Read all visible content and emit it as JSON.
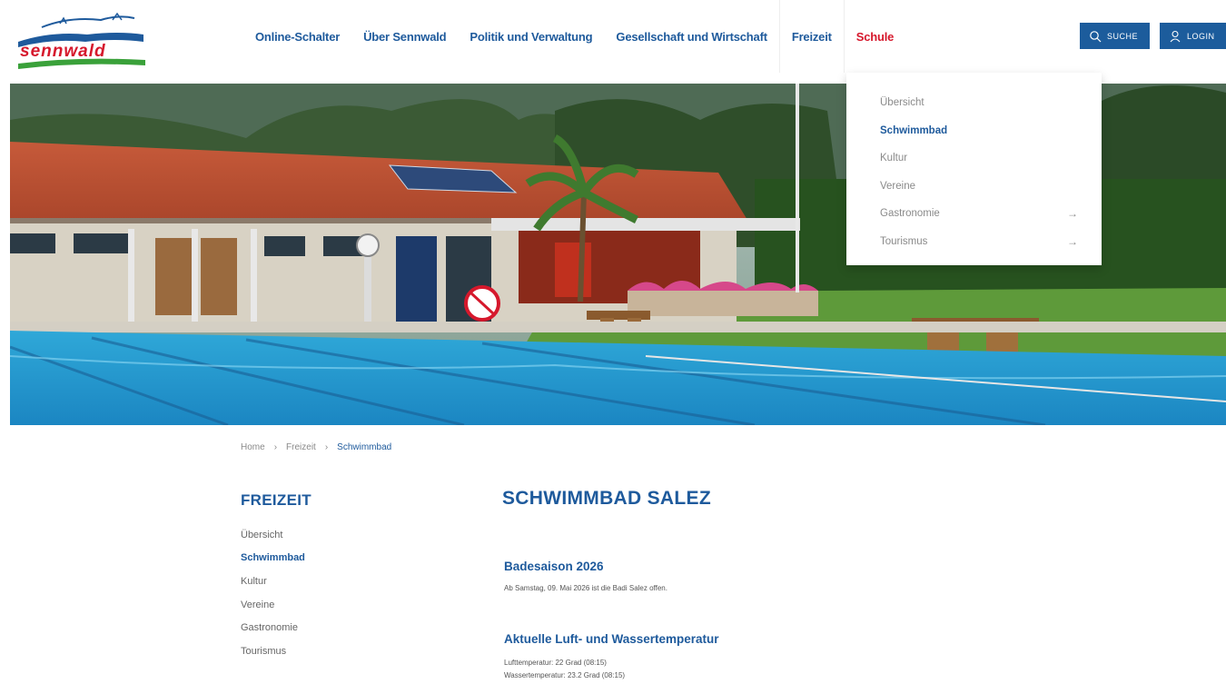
{
  "colors": {
    "brand_blue": "#1e5a9c",
    "accent_red": "#d6182c",
    "button_blue": "#1c5c9c"
  },
  "logo": {
    "text": "sennwald"
  },
  "nav": {
    "items": [
      {
        "label": "Online-Schalter"
      },
      {
        "label": "Über Sennwald"
      },
      {
        "label": "Politik und Verwaltung"
      },
      {
        "label": "Gesellschaft und Wirtschaft"
      },
      {
        "label": "Freizeit"
      },
      {
        "label": "Schule"
      }
    ]
  },
  "header_buttons": {
    "search": "SUCHE",
    "login": "LOGIN"
  },
  "dropdown": {
    "items": [
      {
        "label": "Übersicht",
        "arrow": ""
      },
      {
        "label": "Schwimmbad",
        "arrow": ""
      },
      {
        "label": "Kultur",
        "arrow": ""
      },
      {
        "label": "Vereine",
        "arrow": ""
      },
      {
        "label": "Gastronomie",
        "arrow": "→"
      },
      {
        "label": "Tourismus",
        "arrow": "→"
      }
    ]
  },
  "breadcrumb": {
    "home": "Home",
    "sep": "›",
    "level1": "Freizeit",
    "current": "Schwimmbad"
  },
  "sidebar": {
    "title": "FREIZEIT",
    "items": [
      {
        "label": "Übersicht"
      },
      {
        "label": "Schwimmbad"
      },
      {
        "label": "Kultur"
      },
      {
        "label": "Vereine"
      },
      {
        "label": "Gastronomie"
      },
      {
        "label": "Tourismus"
      }
    ]
  },
  "main": {
    "title": "SCHWIMMBAD SALEZ",
    "season_heading": "Badesaison 2026",
    "season_text": "Ab Samstag, 09. Mai 2026 ist die Badi Salez offen.",
    "temp_heading": "Aktuelle Luft- und Wassertemperatur",
    "air_temp": "Lufttemperatur: 22 Grad (08:15)",
    "water_temp": "Wassertemperatur: 23.2 Grad (08:15)"
  }
}
